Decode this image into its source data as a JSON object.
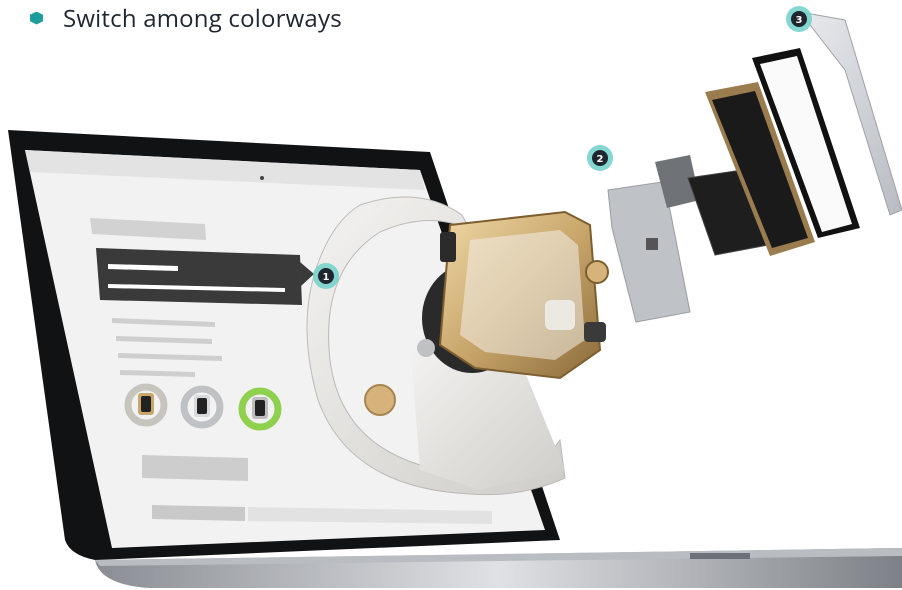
{
  "heading": {
    "text": "Switch among colorways"
  },
  "callouts": [
    {
      "number": "1"
    },
    {
      "number": "2"
    },
    {
      "number": "3"
    }
  ],
  "colors": {
    "accent": "#1e9d9a",
    "text": "#1f2630",
    "gold": "#c9a66b",
    "band": "#e8e7e4",
    "swatch_green": "#8fd14f"
  },
  "icons": [
    "hexagon-bullet-icon",
    "laptop-illustration",
    "watch-illustration",
    "exploded-components"
  ]
}
